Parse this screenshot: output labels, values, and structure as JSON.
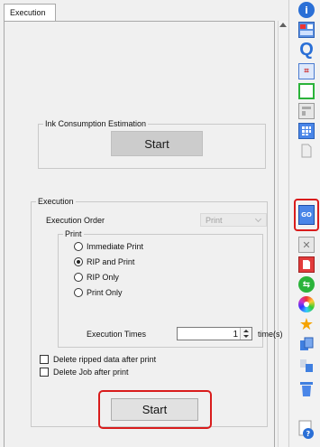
{
  "tab": {
    "label": "Execution"
  },
  "ink_estimation": {
    "legend": "Ink Consumption Estimation",
    "start_label": "Start"
  },
  "execution": {
    "legend": "Execution",
    "order_label": "Execution Order",
    "order_value": "Print",
    "print_group": {
      "legend": "Print",
      "options": [
        {
          "label": "Immediate Print",
          "selected": false
        },
        {
          "label": "RIP and Print",
          "selected": true
        },
        {
          "label": "RIP Only",
          "selected": false
        },
        {
          "label": "Print Only",
          "selected": false
        }
      ],
      "times_label": "Execution Times",
      "times_value": "1",
      "times_unit": "time(s)"
    },
    "delete_ripped_label": "Delete ripped data after print",
    "delete_ripped_checked": false,
    "delete_job_label": "Delete Job after print",
    "delete_job_checked": false,
    "start_label": "Start"
  },
  "colors": {
    "highlight": "#d91c1c",
    "toolbar_blue": "#2a6fd6"
  },
  "toolbar": {
    "icons": [
      "info-icon",
      "job-list-icon",
      "preview-icon",
      "crop-icon",
      "frame-icon",
      "layout-icon",
      "tile-icon",
      "document-icon",
      "execution-icon",
      "color-replace-icon",
      "correction-icon",
      "step-repeat-icon",
      "color-wheel-icon",
      "favorite-star-icon",
      "copy-icon",
      "move-icon",
      "trash-icon",
      "help-icon"
    ]
  }
}
